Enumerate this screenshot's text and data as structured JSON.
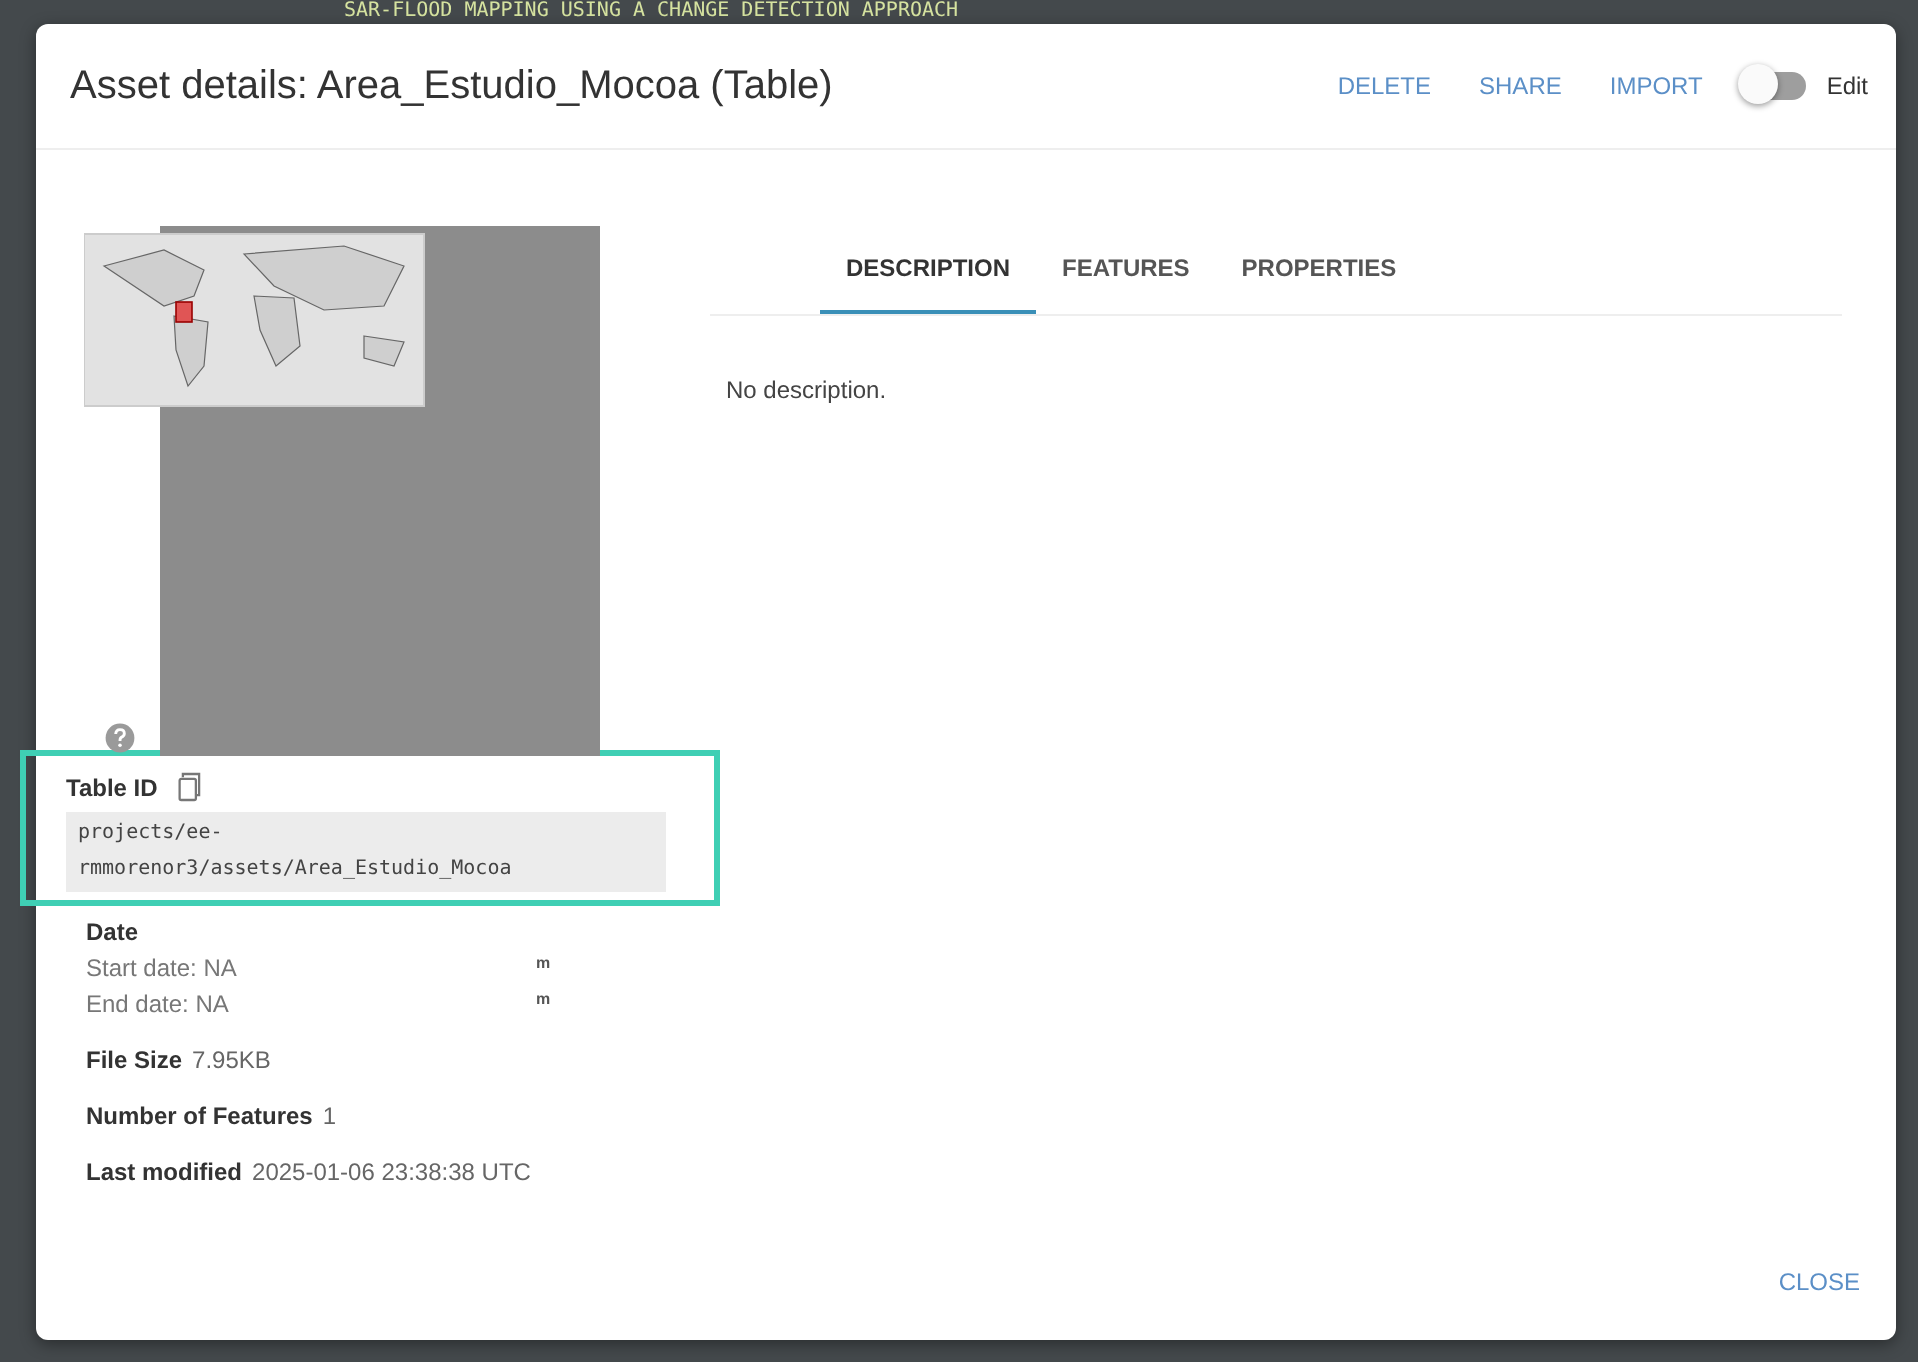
{
  "background_title": "SAR-FLOOD MAPPING USING A CHANGE DETECTION APPROACH",
  "dialog": {
    "title": "Asset details: Area_Estudio_Mocoa (Table)",
    "actions": [
      "DELETE",
      "SHARE",
      "IMPORT"
    ],
    "edit_toggle": {
      "label": "Edit",
      "on": false
    },
    "table_id": {
      "label": "Table ID",
      "value": "projects/ee-rmmorenor3/assets/Area_Estudio_Mocoa",
      "highlighted": true
    },
    "date": {
      "heading": "Date",
      "rows": [
        {
          "label": "Start date:",
          "value": "NA",
          "mark": "m"
        },
        {
          "label": "End date:",
          "value": "NA",
          "mark": "m"
        }
      ]
    },
    "fields": [
      {
        "label": "File Size",
        "value": "7.95KB"
      },
      {
        "label": "Number of Features",
        "value": "1"
      },
      {
        "label": "Last modified",
        "value": "2025-01-06 23:38:38 UTC"
      }
    ],
    "tabs": [
      {
        "label": "DESCRIPTION",
        "selected": true
      },
      {
        "label": "FEATURES",
        "selected": false
      },
      {
        "label": "PROPERTIES",
        "selected": false
      }
    ],
    "description": "No description.",
    "close_button": "CLOSE"
  }
}
